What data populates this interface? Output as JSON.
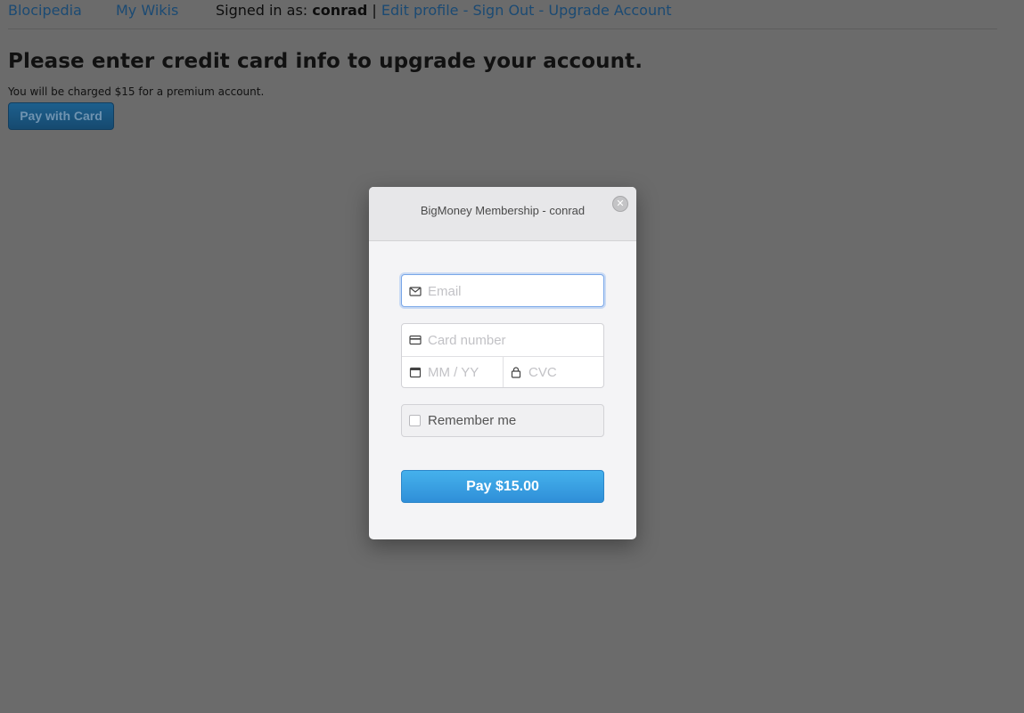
{
  "nav": {
    "brand": "Blocipedia",
    "my_wikis": "My Wikis",
    "signed_in_prefix": "Signed in as:",
    "username": "conrad",
    "divider": "|",
    "edit_profile": "Edit profile",
    "dash1": "-",
    "sign_out": "Sign Out",
    "dash2": "-",
    "upgrade": "Upgrade Account"
  },
  "main": {
    "heading": "Please enter credit card info to upgrade your account.",
    "note": "You will be charged $15 for a premium account.",
    "pay_with_card": "Pay with Card"
  },
  "modal": {
    "title": "BigMoney Membership - conrad",
    "close_glyph": "✕",
    "email_placeholder": "Email",
    "card_placeholder": "Card number",
    "expiry_placeholder": "MM / YY",
    "cvc_placeholder": "CVC",
    "remember_label": "Remember me",
    "pay_button": "Pay $15.00"
  },
  "colors": {
    "overlay": "#6b6b6b",
    "link": "#1b4a73",
    "pay_button": "#3a9fe3",
    "focus_border": "#7aa7e8"
  }
}
